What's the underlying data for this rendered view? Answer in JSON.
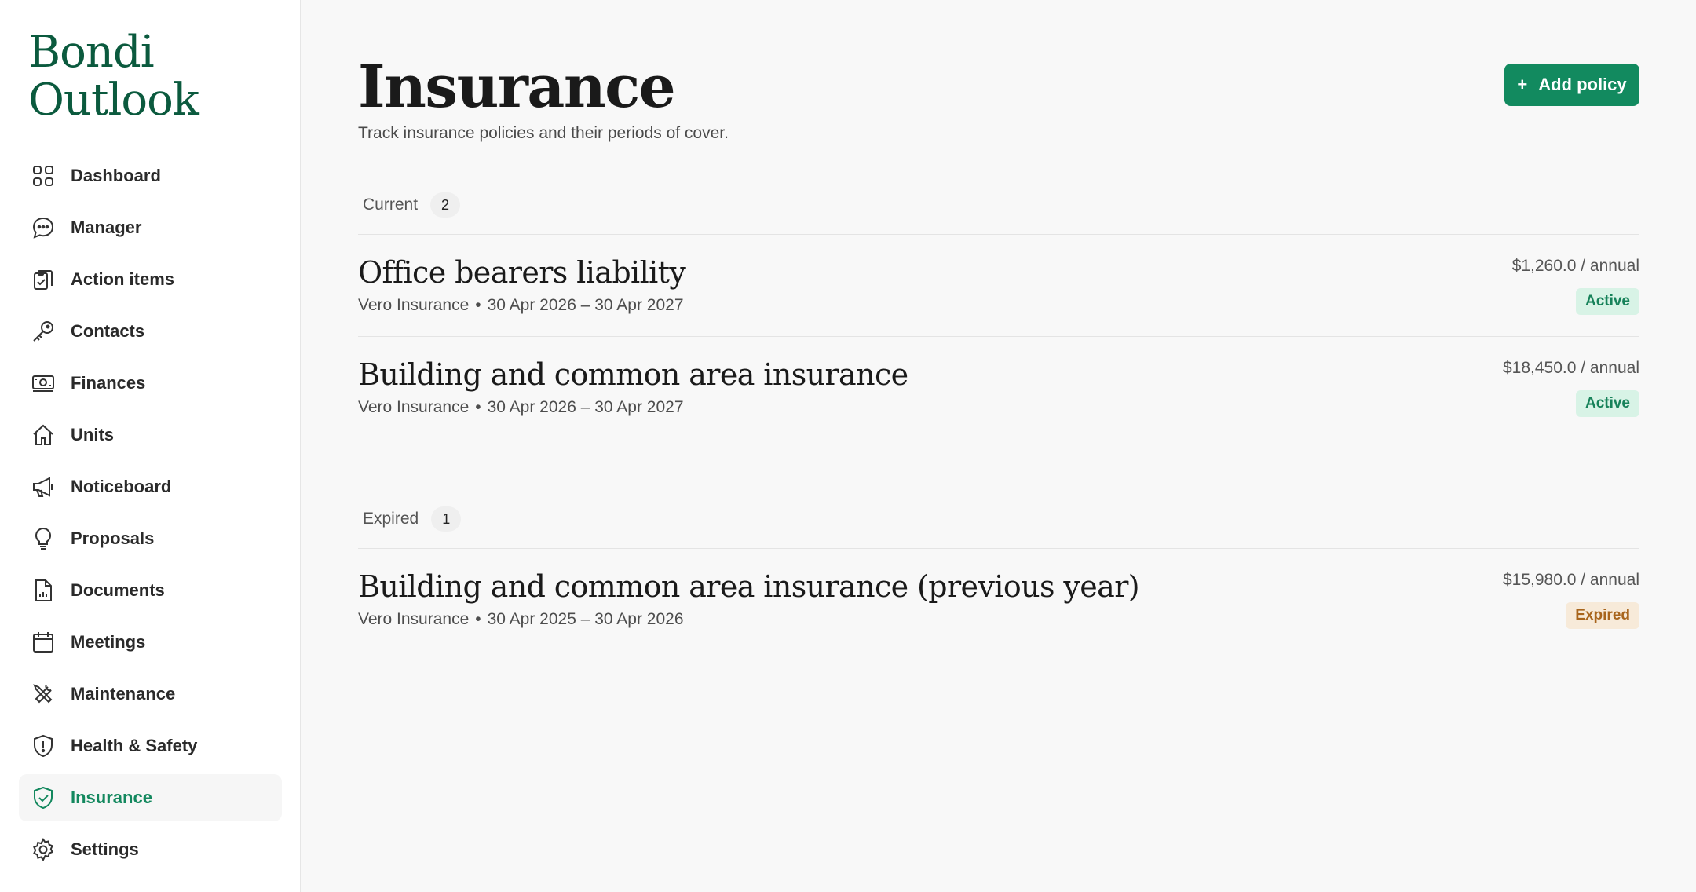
{
  "brand": {
    "line1": "Bondi",
    "line2": "Outlook"
  },
  "sidebar": {
    "items": [
      {
        "label": "Dashboard",
        "icon": "grid-icon"
      },
      {
        "label": "Manager",
        "icon": "chat-bubble-icon"
      },
      {
        "label": "Action items",
        "icon": "clipboard-check-icon"
      },
      {
        "label": "Contacts",
        "icon": "key-icon"
      },
      {
        "label": "Finances",
        "icon": "banknote-icon"
      },
      {
        "label": "Units",
        "icon": "home-icon"
      },
      {
        "label": "Noticeboard",
        "icon": "megaphone-icon"
      },
      {
        "label": "Proposals",
        "icon": "lightbulb-icon"
      },
      {
        "label": "Documents",
        "icon": "document-chart-icon"
      },
      {
        "label": "Meetings",
        "icon": "calendar-icon"
      },
      {
        "label": "Maintenance",
        "icon": "tools-icon"
      },
      {
        "label": "Health & Safety",
        "icon": "shield-alert-icon"
      },
      {
        "label": "Insurance",
        "icon": "shield-check-icon",
        "active": true
      },
      {
        "label": "Settings",
        "icon": "gear-icon"
      }
    ]
  },
  "page": {
    "title": "Insurance",
    "subtitle": "Track insurance policies and their periods of cover.",
    "add_button": {
      "icon": "+",
      "label": "Add policy"
    }
  },
  "sections": {
    "current": {
      "label": "Current",
      "count": "2",
      "policies": [
        {
          "title": "Office bearers liability",
          "insurer": "Vero Insurance",
          "period": "30 Apr 2026 – 30 Apr 2027",
          "price": "$1,260.0 / annual",
          "status": "Active"
        },
        {
          "title": "Building and common area insurance",
          "insurer": "Vero Insurance",
          "period": "30 Apr 2026 – 30 Apr 2027",
          "price": "$18,450.0 / annual",
          "status": "Active"
        }
      ]
    },
    "expired": {
      "label": "Expired",
      "count": "1",
      "policies": [
        {
          "title": "Building and common area insurance (previous year)",
          "insurer": "Vero Insurance",
          "period": "30 Apr 2025 – 30 Apr 2026",
          "price": "$15,980.0 / annual",
          "status": "Expired"
        }
      ]
    }
  },
  "colors": {
    "brand_green": "#0b5a3e",
    "accent_green": "#128a5f",
    "active_badge_bg": "#d8f3e6",
    "expired_badge_bg": "#f7ead9",
    "expired_badge_text": "#a8651d"
  }
}
